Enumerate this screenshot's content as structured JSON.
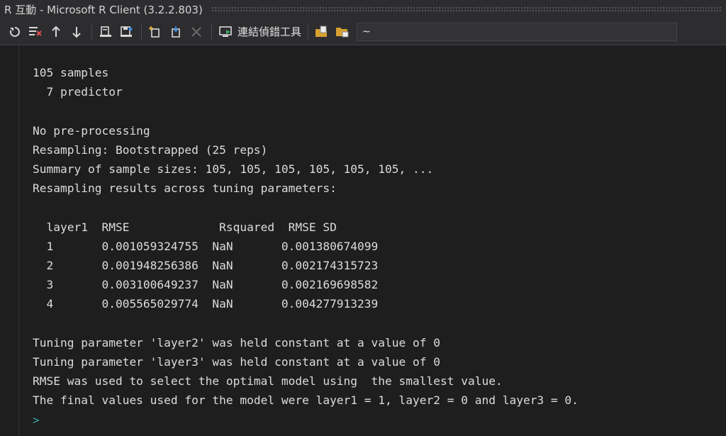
{
  "window": {
    "title": "R 互動 - Microsoft R Client (3.2.2.803)"
  },
  "toolbar": {
    "connect_label": "連結偵錯工具",
    "path_value": "~",
    "buttons": [
      "reset-icon",
      "clear-icon",
      "history-up-icon",
      "history-down-icon",
      "load-workspace-icon",
      "save-workspace-icon",
      "new-icon",
      "copy-icon",
      "cancel-icon",
      "connect-debugger-icon",
      "open-folder-icon",
      "set-working-dir-icon"
    ]
  },
  "console": {
    "lines": [
      "105 samples",
      "  7 predictor",
      "",
      "No pre-processing",
      "Resampling: Bootstrapped (25 reps)",
      "Summary of sample sizes: 105, 105, 105, 105, 105, 105, ...",
      "Resampling results across tuning parameters:",
      "",
      "  layer1  RMSE             Rsquared  RMSE SD",
      "  1       0.001059324755  NaN       0.001380674099",
      "  2       0.001948256386  NaN       0.002174315723",
      "  3       0.003100649237  NaN       0.002169698582",
      "  4       0.005565029774  NaN       0.004277913239",
      "",
      "Tuning parameter 'layer2' was held constant at a value of 0",
      "Tuning parameter 'layer3' was held constant at a value of 0",
      "RMSE was used to select the optimal model using  the smallest value.",
      "The final values used for the model were layer1 = 1, layer2 = 0 and layer3 = 0."
    ],
    "prompt": ">"
  },
  "colors": {
    "background": "#1e1e1e",
    "text": "#dcdcdc",
    "prompt": "#3aa6a6",
    "toolbar": "#2d2d30"
  }
}
